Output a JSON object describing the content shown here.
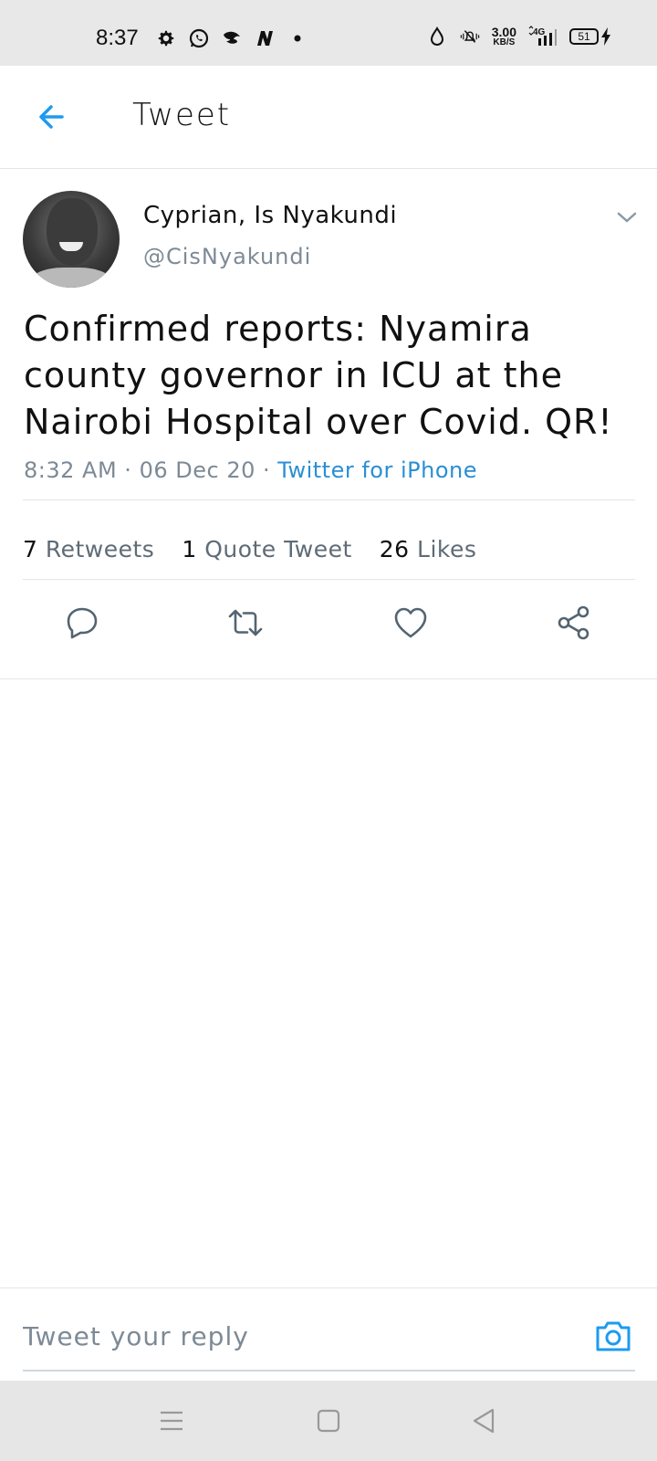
{
  "status_bar": {
    "time": "8:37",
    "left_icons": [
      "gear-icon",
      "whatsapp-icon",
      "bird-icon",
      "nubia-n-icon",
      "dot-icon"
    ],
    "net_speed_value": "3.00",
    "net_speed_unit": "KB/S",
    "network": "4G",
    "battery": "51"
  },
  "header": {
    "title": "Tweet",
    "back_icon": "arrow-left-icon"
  },
  "tweet": {
    "display_name": "Cyprian, Is Nyakundi",
    "handle": "@CisNyakundi",
    "text": "Confirmed reports: Nyamira county governor in ICU at the Nairobi Hospital over Covid. QR!",
    "time": "8:32 AM",
    "date": "06 Dec 20",
    "separator": "·",
    "source": "Twitter for iPhone"
  },
  "stats": {
    "retweets_count": "7",
    "retweets_label": "Retweets",
    "quotes_count": "1",
    "quotes_label": "Quote Tweet",
    "likes_count": "26",
    "likes_label": "Likes"
  },
  "actions": [
    "reply-icon",
    "retweet-icon",
    "like-icon",
    "share-icon"
  ],
  "reply": {
    "placeholder": "Tweet your reply",
    "camera_icon": "camera-icon"
  },
  "nav": [
    "menu-icon",
    "home-square-icon",
    "back-triangle-icon"
  ],
  "colors": {
    "accent": "#1d9bf0",
    "link": "#2a8fd4",
    "muted": "#7d8a96",
    "icon": "#536471",
    "status_bar_bg": "#e8e8e8"
  }
}
